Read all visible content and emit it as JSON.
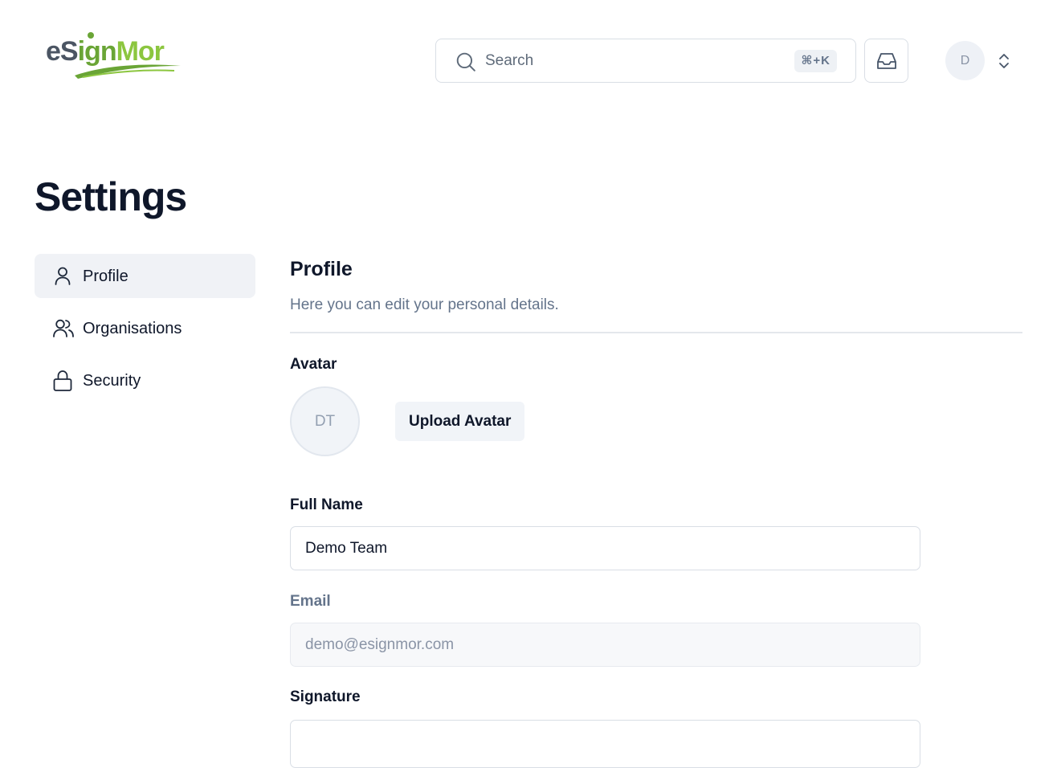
{
  "brand": {
    "logo_text_e": "e",
    "logo_text_s": "S",
    "logo_text_ign": "ign",
    "logo_text_mor": "Mor",
    "logo_alt": "eSignMor"
  },
  "header": {
    "search": {
      "placeholder": "Search",
      "shortcut": "⌘+K",
      "icon": "search-icon"
    },
    "inbox_icon": "inbox-icon",
    "user": {
      "initial": "D",
      "chevron_icon": "chevron-up-down-icon"
    }
  },
  "page": {
    "title": "Settings"
  },
  "sidebar": {
    "items": [
      {
        "label": "Profile",
        "icon": "user-icon",
        "active": true
      },
      {
        "label": "Organisations",
        "icon": "users-icon",
        "active": false
      },
      {
        "label": "Security",
        "icon": "lock-icon",
        "active": false
      }
    ]
  },
  "profile": {
    "title": "Profile",
    "description": "Here you can edit your personal details.",
    "avatar": {
      "label": "Avatar",
      "initials": "DT",
      "upload_label": "Upload Avatar"
    },
    "full_name": {
      "label": "Full Name",
      "value": "Demo Team"
    },
    "email": {
      "label": "Email",
      "value": "demo@esignmor.com"
    },
    "signature": {
      "label": "Signature"
    }
  },
  "colors": {
    "brand_gray": "#4b5563",
    "brand_green": "#8cc63f",
    "text_primary": "#0f172a",
    "text_muted": "#64748b",
    "active_bg": "#f0f2f6"
  }
}
